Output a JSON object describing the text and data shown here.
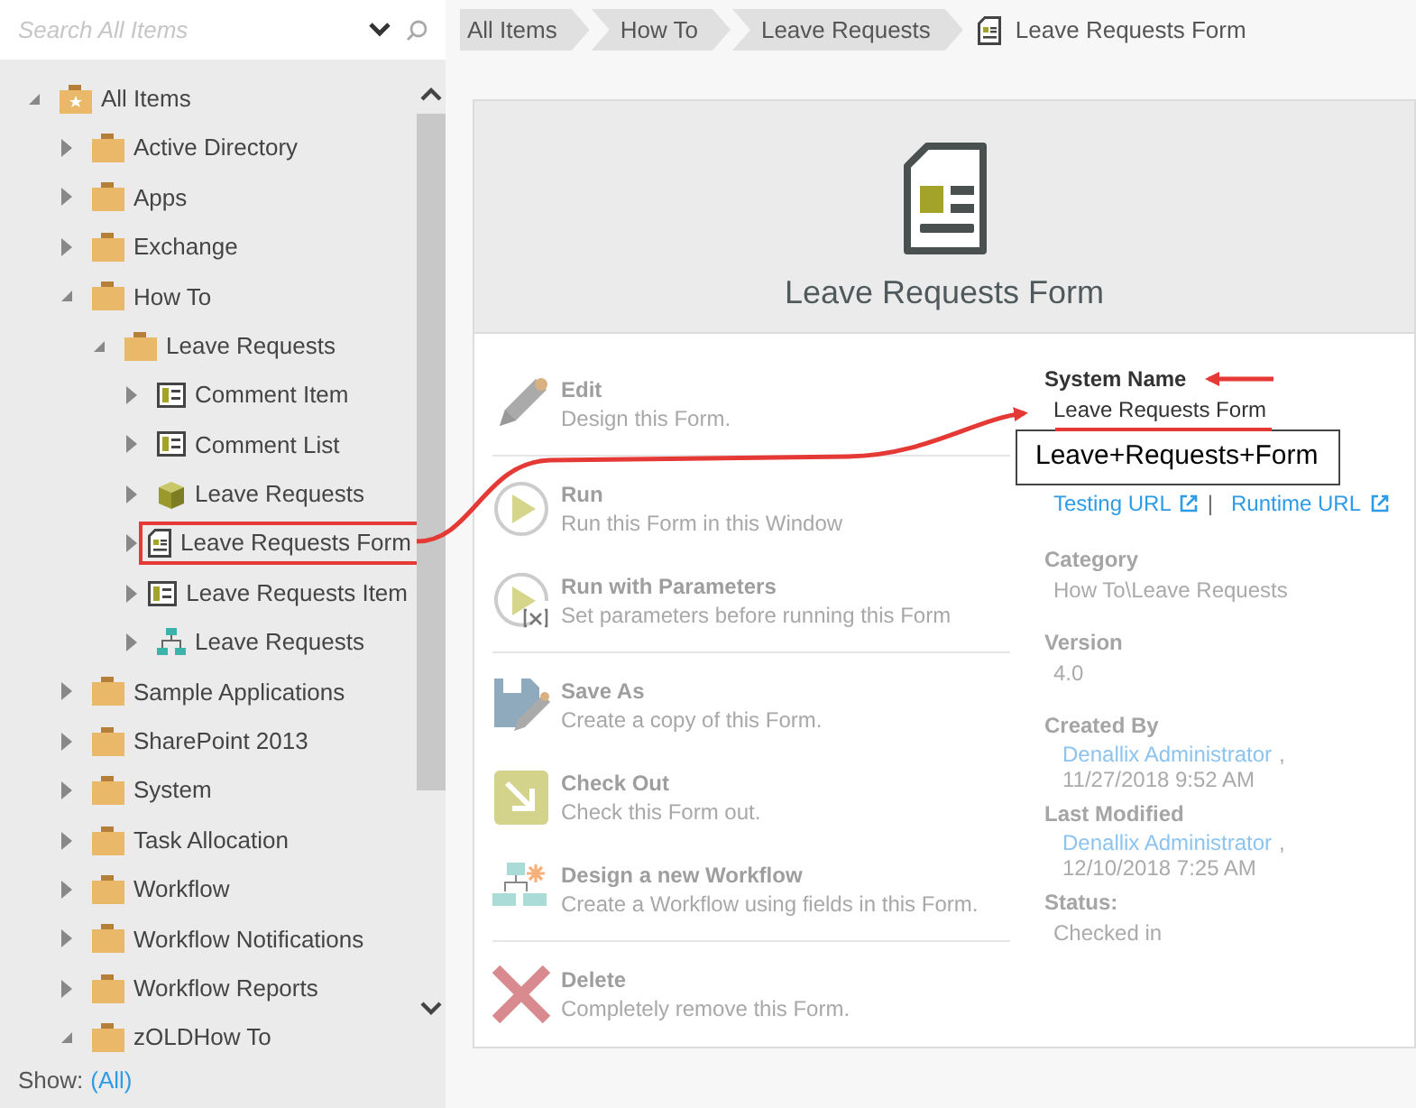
{
  "search": {
    "placeholder": "Search All Items"
  },
  "tree": [
    {
      "label": "All Items",
      "kind": "root",
      "expanded": true,
      "highlighted": false,
      "children": [
        {
          "label": "Active Directory",
          "kind": "folder",
          "expanded": false,
          "highlighted": false
        },
        {
          "label": "Apps",
          "kind": "folder",
          "expanded": false,
          "highlighted": false
        },
        {
          "label": "Exchange",
          "kind": "folder",
          "expanded": false,
          "highlighted": false
        },
        {
          "label": "How To",
          "kind": "folder",
          "expanded": true,
          "highlighted": false,
          "children": [
            {
              "label": "Leave Requests",
              "kind": "folder",
              "expanded": true,
              "highlighted": false,
              "children": [
                {
                  "label": "Comment Item",
                  "kind": "view",
                  "expanded": false,
                  "highlighted": false
                },
                {
                  "label": "Comment List",
                  "kind": "view",
                  "expanded": false,
                  "highlighted": false
                },
                {
                  "label": "Leave Requests",
                  "kind": "smartobject",
                  "expanded": false,
                  "highlighted": false
                },
                {
                  "label": "Leave Requests Form",
                  "kind": "form",
                  "expanded": false,
                  "highlighted": true
                },
                {
                  "label": "Leave Requests Item",
                  "kind": "view",
                  "expanded": false,
                  "highlighted": false
                },
                {
                  "label": "Leave Requests",
                  "kind": "workflow",
                  "expanded": false,
                  "highlighted": false
                }
              ]
            }
          ]
        },
        {
          "label": "Sample Applications",
          "kind": "folder",
          "expanded": false,
          "highlighted": false
        },
        {
          "label": "SharePoint 2013",
          "kind": "folder",
          "expanded": false,
          "highlighted": false
        },
        {
          "label": "System",
          "kind": "folder",
          "expanded": false,
          "highlighted": false
        },
        {
          "label": "Task Allocation",
          "kind": "folder",
          "expanded": false,
          "highlighted": false
        },
        {
          "label": "Workflow",
          "kind": "folder",
          "expanded": false,
          "highlighted": false
        },
        {
          "label": "Workflow Notifications",
          "kind": "folder",
          "expanded": false,
          "highlighted": false
        },
        {
          "label": "Workflow Reports",
          "kind": "folder",
          "expanded": false,
          "highlighted": false
        },
        {
          "label": "zOLDHow To",
          "kind": "folder",
          "expanded": true,
          "highlighted": false
        }
      ]
    }
  ],
  "footer": {
    "label": "Show:",
    "value": "(All)"
  },
  "breadcrumb": [
    {
      "label": "All Items",
      "kind": "crumb"
    },
    {
      "label": "How To",
      "kind": "crumb"
    },
    {
      "label": "Leave Requests",
      "kind": "crumb"
    },
    {
      "label": "Leave Requests Form",
      "kind": "current"
    }
  ],
  "header": {
    "title": "Leave Requests Form"
  },
  "action_groups": [
    [
      {
        "title": "Edit",
        "description": "Design this Form.",
        "kind": "pencil"
      }
    ],
    [
      {
        "title": "Run",
        "description": "Run this Form in this Window",
        "kind": "run"
      },
      {
        "title": "Run with Parameters",
        "description": "Set parameters before running this Form",
        "kind": "run-params"
      }
    ],
    [
      {
        "title": "Save As",
        "description": "Create a copy of this Form.",
        "kind": "save"
      },
      {
        "title": "Check Out",
        "description": "Check this Form out.",
        "kind": "checkout"
      },
      {
        "title": "Design a new Workflow",
        "description": "Create a Workflow using fields in this Form.",
        "kind": "workflow"
      }
    ],
    [
      {
        "title": "Delete",
        "description": "Completely remove this Form.",
        "kind": "delete"
      }
    ]
  ],
  "details": [
    {
      "kind": "text",
      "label": "System Name",
      "value": "Leave Requests Form",
      "strong": true
    },
    {
      "kind": "callout",
      "value": "Leave+Requests+Form"
    },
    {
      "kind": "links",
      "links": [
        "Testing URL",
        "Runtime URL"
      ],
      "separator": "|"
    },
    {
      "kind": "text",
      "label": "Category",
      "value": "How To\\Leave Requests",
      "strong": false
    },
    {
      "kind": "text",
      "label": "Version",
      "value": "4.0",
      "strong": false
    },
    {
      "kind": "user",
      "label": "Created By",
      "user": "Denallix Administrator",
      "separator": ",",
      "date": "11/27/2018 9:52 AM"
    },
    {
      "kind": "user",
      "label": "Last Modified",
      "user": "Denallix Administrator",
      "separator": ",",
      "date": "12/10/2018 7:25 AM"
    },
    {
      "kind": "text",
      "label": "Status:",
      "value": "Checked in",
      "strong": false
    }
  ]
}
